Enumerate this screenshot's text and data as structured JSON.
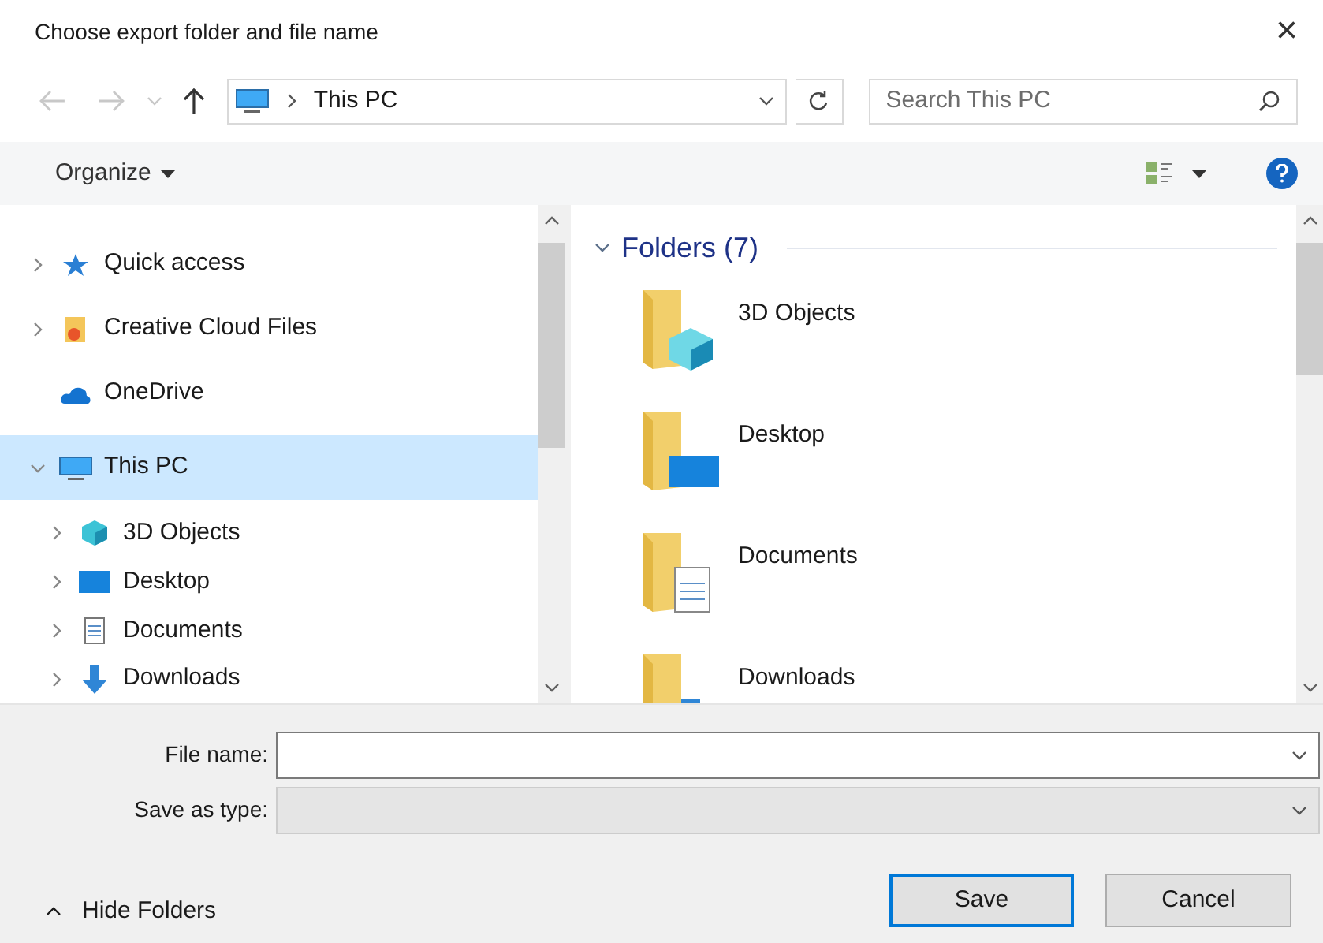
{
  "window": {
    "title": "Choose export folder and file name",
    "close": "×"
  },
  "address_bar": {
    "location": "This PC"
  },
  "search": {
    "placeholder": "Search This PC"
  },
  "toolbar": {
    "organize": "Organize"
  },
  "nav_tree": [
    {
      "label": "Quick access",
      "kind": "quick",
      "has_children": true,
      "expanded": false,
      "selected": false
    },
    {
      "label": "Creative Cloud Files",
      "kind": "cloud",
      "has_children": true,
      "expanded": false,
      "selected": false
    },
    {
      "label": "OneDrive",
      "kind": "onedrive",
      "has_children": false,
      "expanded": false,
      "selected": false
    },
    {
      "label": "This PC",
      "kind": "pc",
      "has_children": true,
      "expanded": true,
      "selected": true,
      "children": [
        {
          "label": "3D Objects",
          "kind": "objects",
          "has_children": true,
          "expanded": false,
          "selected": false
        },
        {
          "label": "Desktop",
          "kind": "desktop",
          "has_children": true,
          "expanded": false,
          "selected": false
        },
        {
          "label": "Documents",
          "kind": "documents",
          "has_children": true,
          "expanded": false,
          "selected": false
        },
        {
          "label": "Downloads",
          "kind": "downloads",
          "has_children": true,
          "expanded": false,
          "selected": false
        }
      ]
    }
  ],
  "content": {
    "group_title": "Folders (7)",
    "expanded": true,
    "folders": [
      {
        "label": "3D Objects",
        "kind": "objects"
      },
      {
        "label": "Desktop",
        "kind": "desktop"
      },
      {
        "label": "Documents",
        "kind": "documents"
      },
      {
        "label": "Downloads",
        "kind": "downloads"
      }
    ]
  },
  "form": {
    "file_name_label": "File name:",
    "save_type_label": "Save as type:"
  },
  "footer": {
    "hide_folders": "Hide Folders",
    "save": "Save",
    "cancel": "Cancel"
  }
}
